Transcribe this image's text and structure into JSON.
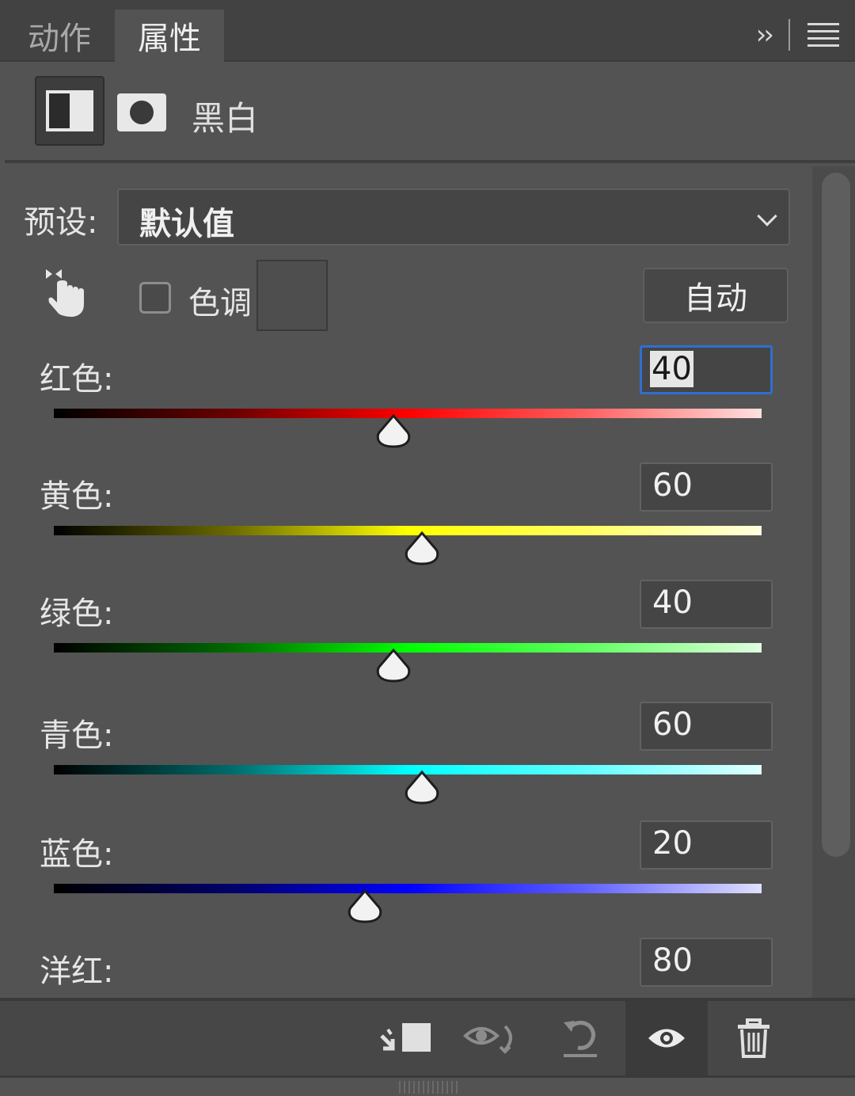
{
  "tabs": [
    {
      "label": "动作",
      "active": false
    },
    {
      "label": "属性",
      "active": true
    }
  ],
  "header": {
    "adjustment_name": "黑白"
  },
  "preset": {
    "label": "预设:",
    "value": "默认值"
  },
  "tint": {
    "label": "色调",
    "checked": false
  },
  "auto_button": "自动",
  "channels": [
    {
      "label": "红色:",
      "value": "40",
      "percent": 40,
      "focused": true
    },
    {
      "label": "黄色:",
      "value": "60",
      "percent": 60,
      "focused": false
    },
    {
      "label": "绿色:",
      "value": "40",
      "percent": 40,
      "focused": false
    },
    {
      "label": "青色:",
      "value": "60",
      "percent": 60,
      "focused": false
    },
    {
      "label": "蓝色:",
      "value": "20",
      "percent": 20,
      "focused": false
    },
    {
      "label": "洋红:",
      "value": "80",
      "percent": 80,
      "focused": false
    }
  ],
  "slider_range": {
    "min": -200,
    "max": 300
  },
  "colors": {
    "panel_bg": "#535353",
    "focus_border": "#2f6fd0"
  },
  "footer_icons": [
    "clip-to-layer-icon",
    "view-previous-state-icon",
    "reset-icon",
    "visibility-eye-icon",
    "trash-icon"
  ]
}
